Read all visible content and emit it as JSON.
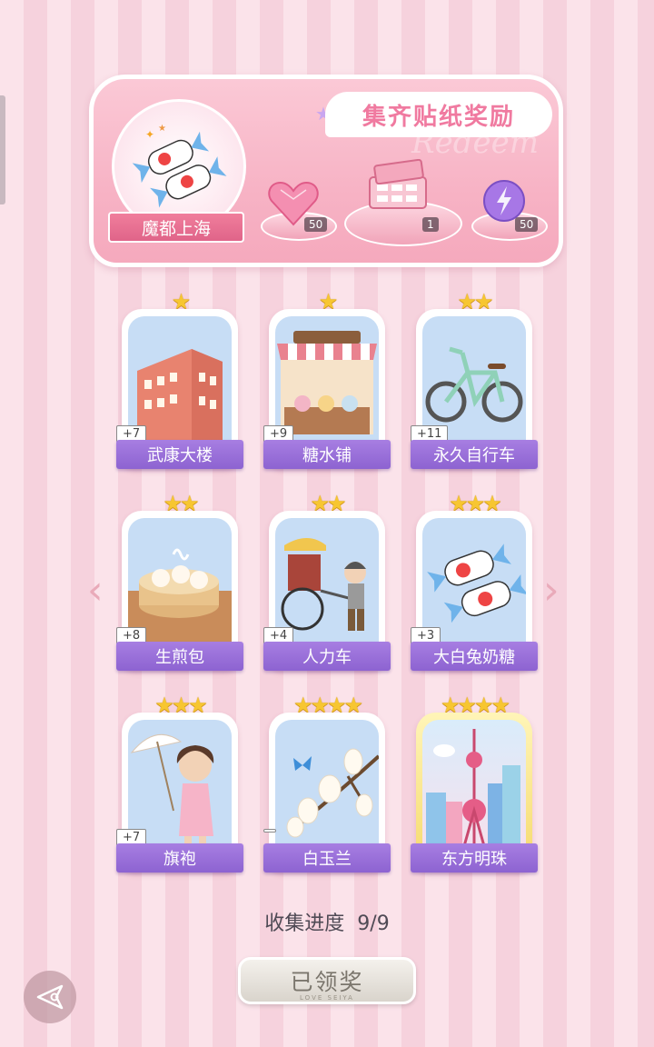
{
  "banner": {
    "title": "集齐贴纸奖励",
    "watermark": "Redeem",
    "city_name": "魔都上海",
    "rewards": [
      {
        "icon": "pink-heart-gem-icon",
        "quantity": "50"
      },
      {
        "icon": "candy-gift-box-icon",
        "quantity": "1"
      },
      {
        "icon": "purple-lightning-orb-icon",
        "quantity": "50"
      }
    ]
  },
  "cards": [
    {
      "name": "武康大楼",
      "stars": "★",
      "count": "+7",
      "icon": "wukang-building-icon"
    },
    {
      "name": "糖水铺",
      "stars": "★",
      "count": "+9",
      "icon": "dessert-shop-icon"
    },
    {
      "name": "永久自行车",
      "stars": "★★",
      "count": "+11",
      "icon": "bicycle-icon"
    },
    {
      "name": "生煎包",
      "stars": "★★",
      "count": "+8",
      "icon": "steamed-buns-icon"
    },
    {
      "name": "人力车",
      "stars": "★★",
      "count": "+4",
      "icon": "rickshaw-icon"
    },
    {
      "name": "大白兔奶糖",
      "stars": "★★★",
      "count": "+3",
      "icon": "white-rabbit-candy-icon"
    },
    {
      "name": "旗袍",
      "stars": "★★★",
      "count": "+7",
      "icon": "qipao-girl-icon"
    },
    {
      "name": "白玉兰",
      "stars": "★★★★",
      "count": "",
      "icon": "magnolia-icon"
    },
    {
      "name": "东方明珠",
      "stars": "★★★★",
      "count": "",
      "icon": "oriental-pearl-tower-icon"
    }
  ],
  "progress": {
    "label": "收集进度",
    "value": "9/9"
  },
  "claim_button": {
    "label": "已领奖",
    "subtext": "LOVE SEIYA"
  },
  "colors": {
    "accent_purple": "#8d63d1",
    "pink": "#f07aa0",
    "star_gold": "#f7c631"
  }
}
